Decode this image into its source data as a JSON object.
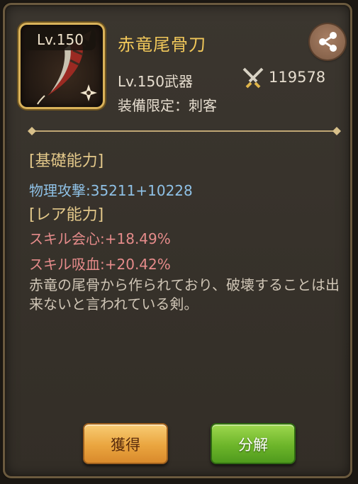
{
  "item": {
    "level_badge": "Lv.150",
    "name": "赤竜尾骨刀",
    "type": "Lv.150武器",
    "power": "119578",
    "equip_limit": "装備限定：刺客",
    "icon": "curved-blade-icon",
    "class_emblem": "shuriken-icon"
  },
  "sections": {
    "basic_title": "[基礎能力]",
    "basic_stat": "物理攻撃:35211+10228",
    "rare_title": "[レア能力]",
    "rare_stats": [
      "スキル会心:+18.49%",
      "スキル吸血:+20.42%"
    ]
  },
  "description": "赤竜の尾骨から作られており、破壊することは出来ないと言われている剣。",
  "buttons": {
    "obtain": "獲得",
    "dismantle": "分解"
  },
  "colors": {
    "name_gold": "#f0c75a",
    "basic_stat_blue": "#8fc1e6",
    "rare_stat_red": "#e58b8a",
    "obtain_orange": "#eaa53f",
    "dismantle_green": "#6db52a"
  }
}
